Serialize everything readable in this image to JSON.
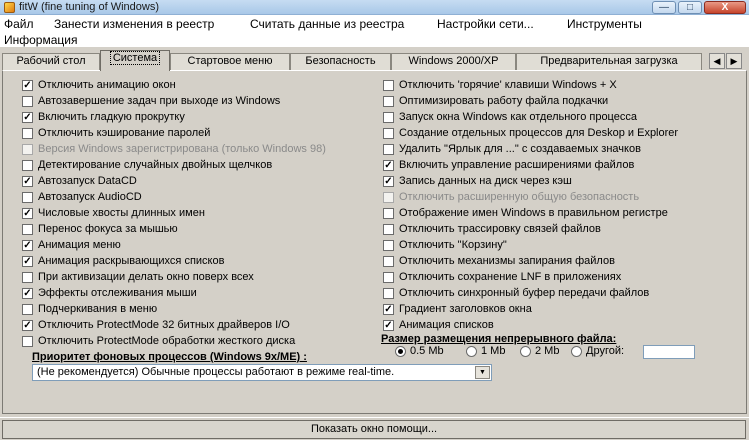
{
  "window": {
    "title": "fitW (fine tuning of Windows)",
    "minimize_glyph": "—",
    "maximize_glyph": "□",
    "close_glyph": "X"
  },
  "menu": {
    "file": "Файл",
    "apply": "Занести изменения в реестр",
    "read": "Считать данные из реестра",
    "network": "Настройки сети...",
    "tools": "Инструменты",
    "info": "Информация"
  },
  "tabs": {
    "desktop": "Рабочий стол",
    "system": "Система",
    "start_menu": "Стартовое меню",
    "security": "Безопасность",
    "win2000": "Windows 2000/XP",
    "preload": "Предварительная загрузка",
    "left_arrow": "◀",
    "right_arrow": "▶"
  },
  "left_options": [
    {
      "label": "Отключить анимацию окон",
      "checked": true,
      "disabled": false
    },
    {
      "label": "Автозавершение задач при выходе из Windows",
      "checked": false,
      "disabled": false
    },
    {
      "label": "Включить гладкую прокрутку",
      "checked": true,
      "disabled": false
    },
    {
      "label": "Отключить кэширование паролей",
      "checked": false,
      "disabled": false
    },
    {
      "label": "Версия Windows зарегистрирована (только Windows 98)",
      "checked": false,
      "disabled": true
    },
    {
      "label": "Детектирование случайных двойных щелчков",
      "checked": false,
      "disabled": false
    },
    {
      "label": "Автозапуск DataCD",
      "checked": true,
      "disabled": false
    },
    {
      "label": "Автозапуск AudioCD",
      "checked": false,
      "disabled": false
    },
    {
      "label": "Числовые хвосты длинных имен",
      "checked": true,
      "disabled": false
    },
    {
      "label": "Перенос фокуса за мышью",
      "checked": false,
      "disabled": false
    },
    {
      "label": "Анимация меню",
      "checked": true,
      "disabled": false
    },
    {
      "label": "Анимация раскрывающихся списков",
      "checked": true,
      "disabled": false
    },
    {
      "label": "При активизации делать окно поверх всех",
      "checked": false,
      "disabled": false
    },
    {
      "label": "Эффекты отслеживания мыши",
      "checked": true,
      "disabled": false
    },
    {
      "label": "Подчеркивания в меню",
      "checked": false,
      "disabled": false
    },
    {
      "label": "Отключить ProtectMode 32 битных драйверов I/O",
      "checked": true,
      "disabled": false
    },
    {
      "label": "Отключить ProtectMode обработки жесткого диска",
      "checked": false,
      "disabled": false
    }
  ],
  "right_options": [
    {
      "label": "Отключить 'горячие' клавиши Windows + X",
      "checked": false,
      "disabled": false
    },
    {
      "label": "Оптимизировать работу файла подкачки",
      "checked": false,
      "disabled": false
    },
    {
      "label": "Запуск окна Windows как отдельного процесса",
      "checked": false,
      "disabled": false
    },
    {
      "label": "Создание отдельных процессов для Deskop и Explorer",
      "checked": false,
      "disabled": false
    },
    {
      "label": "Удалить \"Ярлык для ...\" с создаваемых значков",
      "checked": false,
      "disabled": false
    },
    {
      "label": "Включить управление расширениями файлов",
      "checked": true,
      "disabled": false
    },
    {
      "label": "Запись данных на диск через кэш",
      "checked": true,
      "disabled": false
    },
    {
      "label": "Отключить расширенную общую безопасность",
      "checked": false,
      "disabled": true
    },
    {
      "label": "Отображение имен Windows в правильном регистре",
      "checked": false,
      "disabled": false
    },
    {
      "label": "Отключить трассировку связей файлов",
      "checked": false,
      "disabled": false
    },
    {
      "label": "Отключить \"Корзину\"",
      "checked": false,
      "disabled": false
    },
    {
      "label": "Отключить механизмы запирания файлов",
      "checked": false,
      "disabled": false
    },
    {
      "label": "Отключить сохранение LNF в приложениях",
      "checked": false,
      "disabled": false
    },
    {
      "label": "Отключить синхронный буфер передачи файлов",
      "checked": false,
      "disabled": false
    },
    {
      "label": "Градиент заголовков окна",
      "checked": true,
      "disabled": false
    },
    {
      "label": "Анимация списков",
      "checked": true,
      "disabled": false
    }
  ],
  "check_glyph": "✓",
  "swap_file": {
    "title": "Размер размещения непрерывного файла:",
    "options": [
      {
        "label": "0.5 Mb",
        "selected": true
      },
      {
        "label": "1 Mb",
        "selected": false
      },
      {
        "label": "2 Mb",
        "selected": false
      },
      {
        "label": "Другой:",
        "selected": false
      }
    ],
    "other_value": ""
  },
  "priority": {
    "title": "Приоритет фоновых процессов (Windows 9x/ME) :",
    "selected": "(Не рекомендуется) Обычные процессы работают в режиме real-time.",
    "arrow": "▼"
  },
  "help_button": "Показать окно помощи..."
}
